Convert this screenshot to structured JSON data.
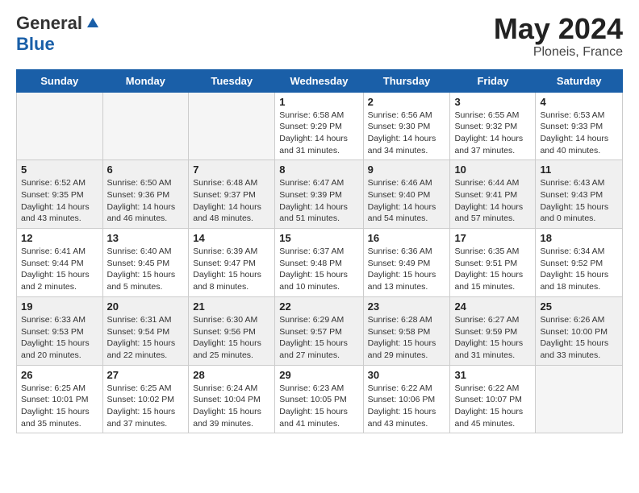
{
  "logo": {
    "general": "General",
    "blue": "Blue"
  },
  "title": {
    "month_year": "May 2024",
    "location": "Ploneis, France"
  },
  "weekdays": [
    "Sunday",
    "Monday",
    "Tuesday",
    "Wednesday",
    "Thursday",
    "Friday",
    "Saturday"
  ],
  "weeks": [
    [
      {
        "day": "",
        "info": ""
      },
      {
        "day": "",
        "info": ""
      },
      {
        "day": "",
        "info": ""
      },
      {
        "day": "1",
        "info": "Sunrise: 6:58 AM\nSunset: 9:29 PM\nDaylight: 14 hours\nand 31 minutes."
      },
      {
        "day": "2",
        "info": "Sunrise: 6:56 AM\nSunset: 9:30 PM\nDaylight: 14 hours\nand 34 minutes."
      },
      {
        "day": "3",
        "info": "Sunrise: 6:55 AM\nSunset: 9:32 PM\nDaylight: 14 hours\nand 37 minutes."
      },
      {
        "day": "4",
        "info": "Sunrise: 6:53 AM\nSunset: 9:33 PM\nDaylight: 14 hours\nand 40 minutes."
      }
    ],
    [
      {
        "day": "5",
        "info": "Sunrise: 6:52 AM\nSunset: 9:35 PM\nDaylight: 14 hours\nand 43 minutes."
      },
      {
        "day": "6",
        "info": "Sunrise: 6:50 AM\nSunset: 9:36 PM\nDaylight: 14 hours\nand 46 minutes."
      },
      {
        "day": "7",
        "info": "Sunrise: 6:48 AM\nSunset: 9:37 PM\nDaylight: 14 hours\nand 48 minutes."
      },
      {
        "day": "8",
        "info": "Sunrise: 6:47 AM\nSunset: 9:39 PM\nDaylight: 14 hours\nand 51 minutes."
      },
      {
        "day": "9",
        "info": "Sunrise: 6:46 AM\nSunset: 9:40 PM\nDaylight: 14 hours\nand 54 minutes."
      },
      {
        "day": "10",
        "info": "Sunrise: 6:44 AM\nSunset: 9:41 PM\nDaylight: 14 hours\nand 57 minutes."
      },
      {
        "day": "11",
        "info": "Sunrise: 6:43 AM\nSunset: 9:43 PM\nDaylight: 15 hours\nand 0 minutes."
      }
    ],
    [
      {
        "day": "12",
        "info": "Sunrise: 6:41 AM\nSunset: 9:44 PM\nDaylight: 15 hours\nand 2 minutes."
      },
      {
        "day": "13",
        "info": "Sunrise: 6:40 AM\nSunset: 9:45 PM\nDaylight: 15 hours\nand 5 minutes."
      },
      {
        "day": "14",
        "info": "Sunrise: 6:39 AM\nSunset: 9:47 PM\nDaylight: 15 hours\nand 8 minutes."
      },
      {
        "day": "15",
        "info": "Sunrise: 6:37 AM\nSunset: 9:48 PM\nDaylight: 15 hours\nand 10 minutes."
      },
      {
        "day": "16",
        "info": "Sunrise: 6:36 AM\nSunset: 9:49 PM\nDaylight: 15 hours\nand 13 minutes."
      },
      {
        "day": "17",
        "info": "Sunrise: 6:35 AM\nSunset: 9:51 PM\nDaylight: 15 hours\nand 15 minutes."
      },
      {
        "day": "18",
        "info": "Sunrise: 6:34 AM\nSunset: 9:52 PM\nDaylight: 15 hours\nand 18 minutes."
      }
    ],
    [
      {
        "day": "19",
        "info": "Sunrise: 6:33 AM\nSunset: 9:53 PM\nDaylight: 15 hours\nand 20 minutes."
      },
      {
        "day": "20",
        "info": "Sunrise: 6:31 AM\nSunset: 9:54 PM\nDaylight: 15 hours\nand 22 minutes."
      },
      {
        "day": "21",
        "info": "Sunrise: 6:30 AM\nSunset: 9:56 PM\nDaylight: 15 hours\nand 25 minutes."
      },
      {
        "day": "22",
        "info": "Sunrise: 6:29 AM\nSunset: 9:57 PM\nDaylight: 15 hours\nand 27 minutes."
      },
      {
        "day": "23",
        "info": "Sunrise: 6:28 AM\nSunset: 9:58 PM\nDaylight: 15 hours\nand 29 minutes."
      },
      {
        "day": "24",
        "info": "Sunrise: 6:27 AM\nSunset: 9:59 PM\nDaylight: 15 hours\nand 31 minutes."
      },
      {
        "day": "25",
        "info": "Sunrise: 6:26 AM\nSunset: 10:00 PM\nDaylight: 15 hours\nand 33 minutes."
      }
    ],
    [
      {
        "day": "26",
        "info": "Sunrise: 6:25 AM\nSunset: 10:01 PM\nDaylight: 15 hours\nand 35 minutes."
      },
      {
        "day": "27",
        "info": "Sunrise: 6:25 AM\nSunset: 10:02 PM\nDaylight: 15 hours\nand 37 minutes."
      },
      {
        "day": "28",
        "info": "Sunrise: 6:24 AM\nSunset: 10:04 PM\nDaylight: 15 hours\nand 39 minutes."
      },
      {
        "day": "29",
        "info": "Sunrise: 6:23 AM\nSunset: 10:05 PM\nDaylight: 15 hours\nand 41 minutes."
      },
      {
        "day": "30",
        "info": "Sunrise: 6:22 AM\nSunset: 10:06 PM\nDaylight: 15 hours\nand 43 minutes."
      },
      {
        "day": "31",
        "info": "Sunrise: 6:22 AM\nSunset: 10:07 PM\nDaylight: 15 hours\nand 45 minutes."
      },
      {
        "day": "",
        "info": ""
      }
    ]
  ]
}
